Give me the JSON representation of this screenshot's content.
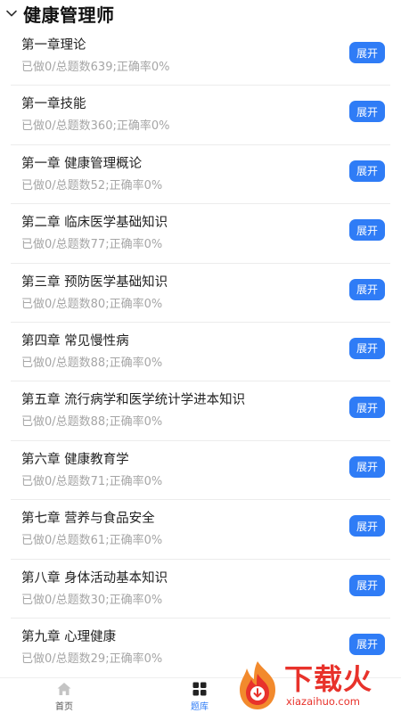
{
  "header": {
    "title": "健康管理师"
  },
  "chapters": [
    {
      "name": "第一章理论",
      "stats": "已做0/总题数639;正确率0%",
      "button": "展开"
    },
    {
      "name": "第一章技能",
      "stats": "已做0/总题数360;正确率0%",
      "button": "展开"
    },
    {
      "name": "第一章  健康管理概论",
      "stats": "已做0/总题数52;正确率0%",
      "button": "展开"
    },
    {
      "name": "第二章 临床医学基础知识",
      "stats": "已做0/总题数77;正确率0%",
      "button": "展开"
    },
    {
      "name": "第三章 预防医学基础知识",
      "stats": "已做0/总题数80;正确率0%",
      "button": "展开"
    },
    {
      "name": "第四章 常见慢性病",
      "stats": "已做0/总题数88;正确率0%",
      "button": "展开"
    },
    {
      "name": "第五章 流行病学和医学统计学进本知识",
      "stats": "已做0/总题数88;正确率0%",
      "button": "展开"
    },
    {
      "name": "第六章 健康教育学",
      "stats": "已做0/总题数71;正确率0%",
      "button": "展开"
    },
    {
      "name": "第七章 营养与食品安全",
      "stats": "已做0/总题数61;正确率0%",
      "button": "展开"
    },
    {
      "name": "第八章 身体活动基本知识",
      "stats": "已做0/总题数30;正确率0%",
      "button": "展开"
    },
    {
      "name": "第九章 心理健康",
      "stats": "已做0/总题数29;正确率0%",
      "button": "展开"
    }
  ],
  "tabbar": {
    "home_label": "首页",
    "bank_label": "题库",
    "active_color": "#2f7cf6"
  },
  "watermark": {
    "big": "下载火",
    "small": "xiazaihuo.com"
  },
  "colors": {
    "accent": "#2f7cf6",
    "watermark": "#e8322b"
  }
}
